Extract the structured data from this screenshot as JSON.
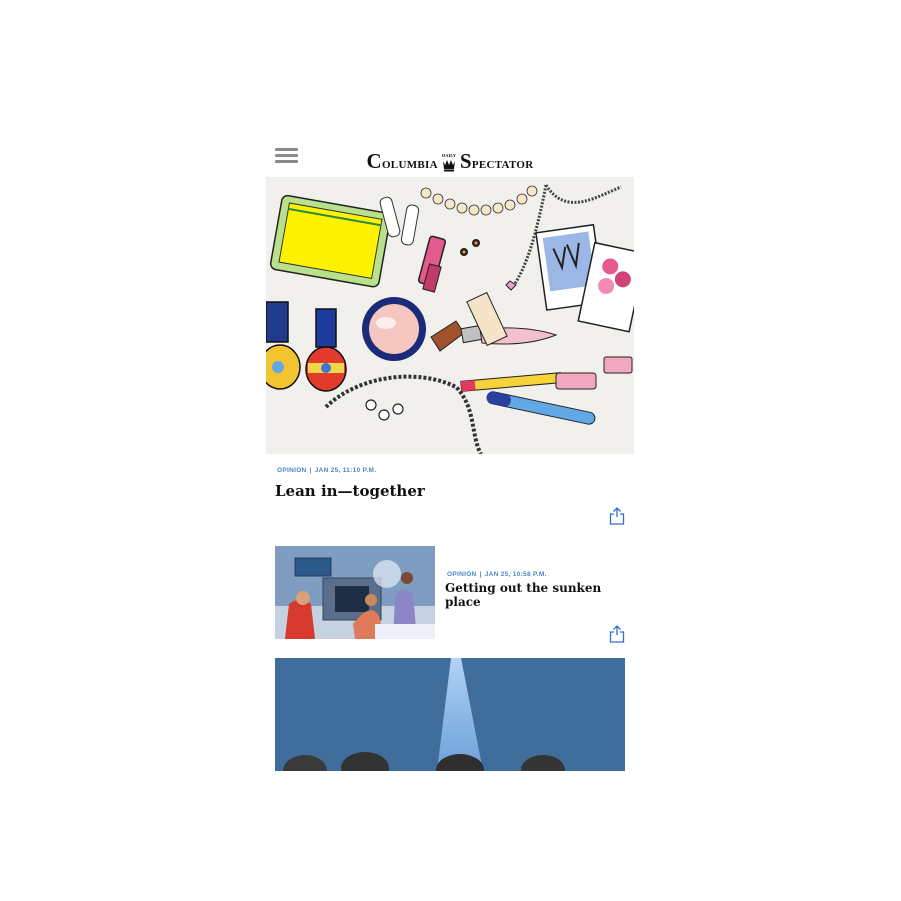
{
  "header": {
    "menu_icon": "hamburger-menu-icon",
    "logo": "Columbia Daily Spectator",
    "logo_left": "Columbia",
    "logo_right": "Spectator"
  },
  "articles": [
    {
      "section": "OPINION",
      "date": "JAN 25, 11:10 P.M.",
      "title": "Lean in—together",
      "share_icon": "share-icon"
    },
    {
      "section": "OPINION",
      "date": "JAN 25, 10:58 P.M.",
      "title": "Getting out the sunken place",
      "share_icon": "share-icon"
    }
  ],
  "colors": {
    "meta_blue": "#4a86c8",
    "share_blue": "#2f6fd0",
    "menu_gray": "#8a8a8a"
  }
}
